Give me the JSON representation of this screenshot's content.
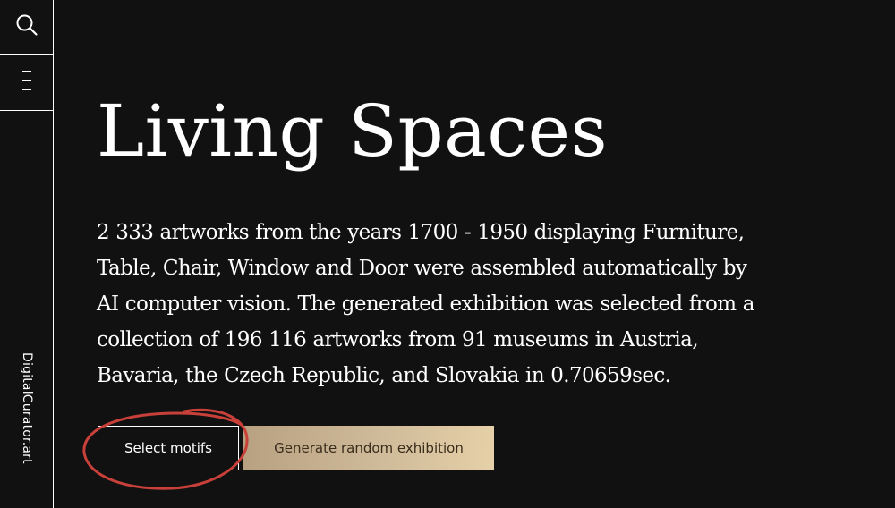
{
  "sidebar": {
    "search_icon": "search-icon",
    "menu_icon": "menu-icon",
    "brand": "DigitalCurator.art"
  },
  "main": {
    "title": "Living Spaces",
    "description_lines": [
      "2 333 artworks from the years 1700 - 1950 displaying Furniture,",
      "Table, Chair, Window and Door were assembled automatically by",
      "AI computer vision. The generated exhibition was selected from a",
      "collection of 196 116 artworks from 91 museums in Austria,",
      "Bavaria, the Czech Republic, and Slovakia in 0.70659sec."
    ],
    "select_motifs_label": "Select motifs",
    "generate_label": "Generate random exhibition"
  },
  "colors": {
    "background": "#111111",
    "text": "#ffffff",
    "gold_gradient_start": "#b8a181",
    "gold_gradient_end": "#e6d0a8",
    "annotation_circle": "#c8403a"
  }
}
